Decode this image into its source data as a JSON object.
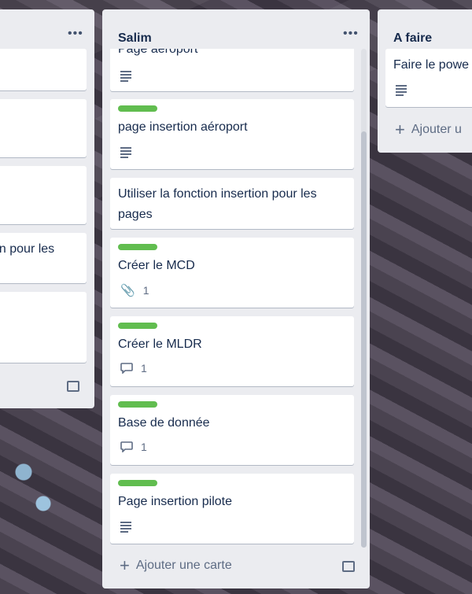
{
  "lists": {
    "left": {
      "menu_icon": "more-dots-icon",
      "card4_text": "on pour les",
      "template_icon": "card-template-icon"
    },
    "salim": {
      "title": "Salim",
      "menu_icon": "more-dots-icon",
      "label_color": "#61bd4f",
      "cards": [
        {
          "title": "Page aéroport",
          "badge": "description"
        },
        {
          "title": "page insertion aéroport",
          "badge": "description"
        },
        {
          "title": "Utiliser la fonction insertion pour les pages"
        },
        {
          "title": "Créer le MCD",
          "badge": "attachment",
          "count": "1"
        },
        {
          "title": "Créer le MLDR",
          "badge": "comment",
          "count": "1"
        },
        {
          "title": "Base de donnée",
          "badge": "comment",
          "count": "1"
        },
        {
          "title": "Page insertion pilote",
          "badge": "description"
        }
      ],
      "add_card": "Ajouter une carte",
      "add_icon": "plus-icon",
      "template_icon": "card-template-icon"
    },
    "afaire": {
      "title": "A faire",
      "cards": [
        {
          "title": "Faire le powe",
          "badge": "description"
        }
      ],
      "add_card": "Ajouter u",
      "add_icon": "plus-icon"
    }
  }
}
